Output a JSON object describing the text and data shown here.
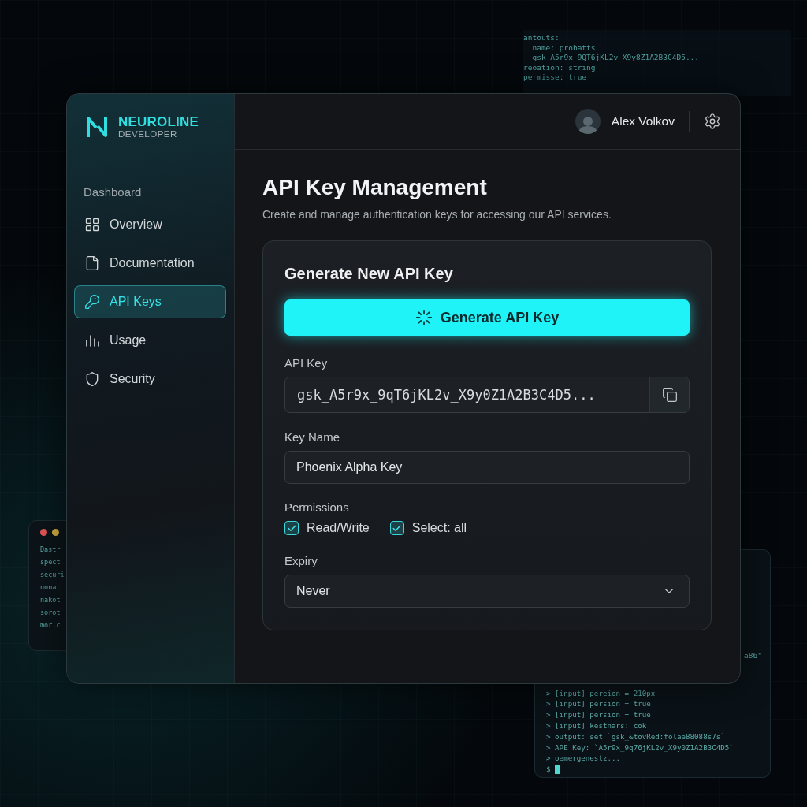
{
  "background_code": {
    "lines": [
      "antouts:",
      "  name: probatts",
      "  gsk_A5r9x_9QT6jKL2v_X9y8Z1A2B3C4D5...",
      "reoation: string",
      "permisse: true"
    ]
  },
  "left_window": {
    "lines": [
      "Dastr",
      "spect",
      "securi",
      "nonat",
      "nakot",
      "sorot",
      "mor.c"
    ]
  },
  "terminal": {
    "fragment": "a86\"",
    "lines": [
      "> [input] pereion = 210px",
      "> [input] persion = true",
      "> [input] persion = true",
      "> [input] kestnars: cok",
      "> output: set `gsk_&tovRed:folae88088s7s`",
      "> APE Key: `A5r9x_9q76jKL2v_X9y0Z1A2B3C4D5`",
      "> oemergenestz..."
    ],
    "prompt": "$"
  },
  "brand": {
    "name": "NEUROLINE",
    "subtitle": "DEVELOPER"
  },
  "user": {
    "name": "Alex Volkov"
  },
  "sidebar": {
    "section": "Dashboard",
    "items": [
      {
        "label": "Overview",
        "kind": "grid",
        "selected": false
      },
      {
        "label": "Documentation",
        "kind": "file",
        "selected": false
      },
      {
        "label": "API Keys",
        "kind": "key",
        "selected": true
      },
      {
        "label": "Usage",
        "kind": "bars",
        "selected": false
      },
      {
        "label": "Security",
        "kind": "shield",
        "selected": false
      }
    ]
  },
  "page": {
    "title": "API Key Management",
    "subtitle": "Create and manage authentication keys for accessing our API services."
  },
  "card": {
    "title": "Generate New API Key",
    "generate_button": {
      "label": "Generate API Key",
      "loading": true
    },
    "api_key": {
      "label": "API Key",
      "value": "gsk_A5r9x_9qT6jKL2v_X9y0Z1A2B3C4D5..."
    },
    "key_name": {
      "label": "Key Name",
      "value": "Phoenix Alpha Key"
    },
    "permissions": {
      "label": "Permissions",
      "options": [
        {
          "label": "Read/Write",
          "checked": true
        },
        {
          "label": "Select: all",
          "checked": true
        }
      ]
    },
    "expiry": {
      "label": "Expiry",
      "value": "Never"
    }
  }
}
